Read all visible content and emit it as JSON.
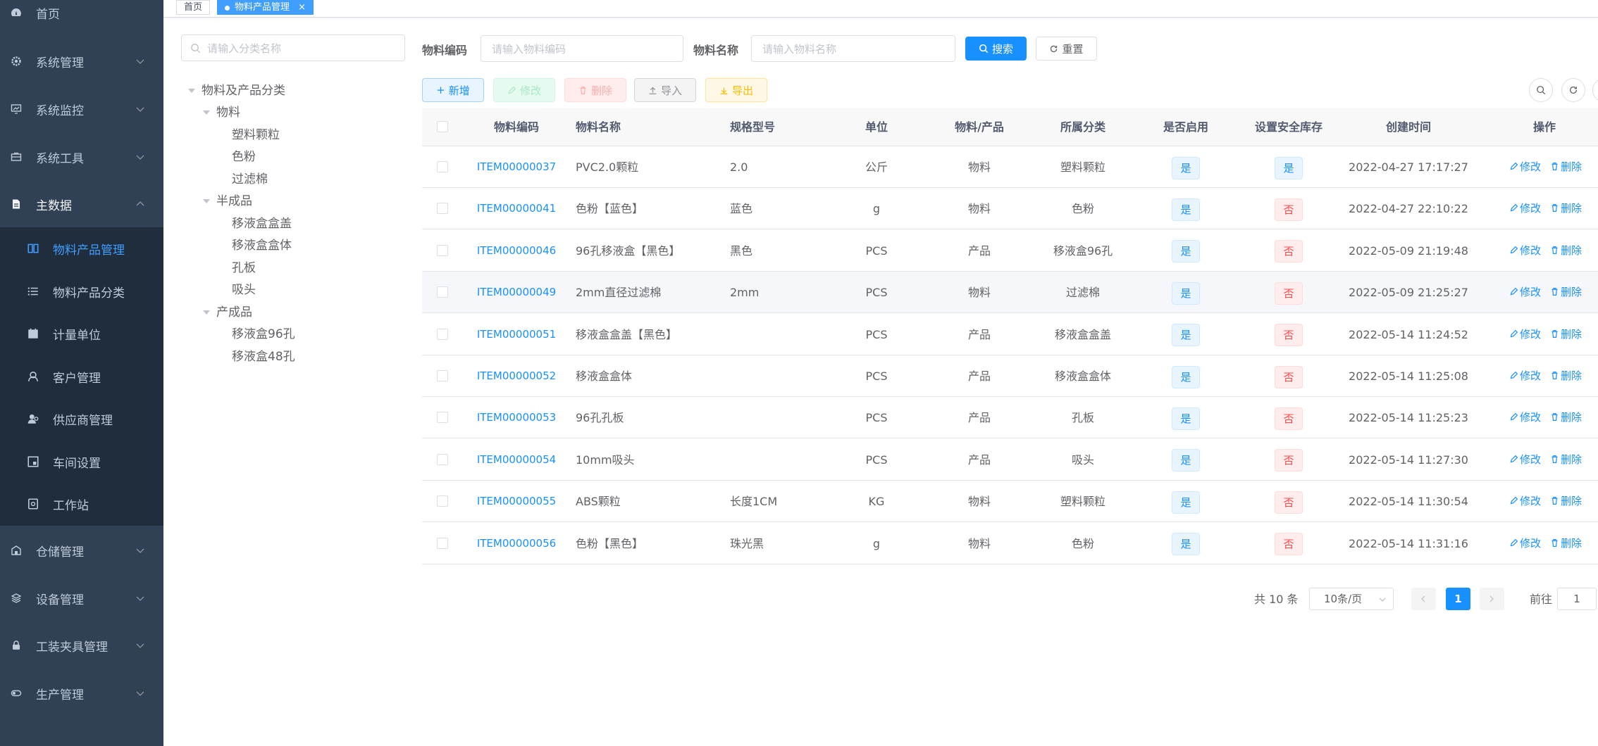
{
  "sidebar": {
    "home": "首页",
    "groups": [
      {
        "label": "系统管理",
        "icon": "gear-icon"
      },
      {
        "label": "系统监控",
        "icon": "monitor-icon"
      },
      {
        "label": "系统工具",
        "icon": "toolbox-icon"
      },
      {
        "label": "主数据",
        "icon": "document-icon"
      },
      {
        "label": "仓储管理",
        "icon": "warehouse-icon"
      },
      {
        "label": "设备管理",
        "icon": "layers-icon"
      },
      {
        "label": "工装夹具管理",
        "icon": "lock-icon"
      },
      {
        "label": "生产管理",
        "icon": "toggle-icon"
      }
    ],
    "sub_items": [
      {
        "label": "物料产品管理",
        "icon": "book-icon"
      },
      {
        "label": "物料产品分类",
        "icon": "list-icon"
      },
      {
        "label": "计量单位",
        "icon": "calendar-icon"
      },
      {
        "label": "客户管理",
        "icon": "customer-icon"
      },
      {
        "label": "供应商管理",
        "icon": "supplier-icon"
      },
      {
        "label": "车间设置",
        "icon": "workshop-icon"
      },
      {
        "label": "工作站",
        "icon": "workstation-icon"
      }
    ]
  },
  "tags": {
    "home": "首页",
    "current": "物料产品管理",
    "close": "×"
  },
  "tree": {
    "search_placeholder": "请输入分类名称",
    "root": "物料及产品分类",
    "groups": [
      {
        "label": "物料",
        "children": [
          "塑料颗粒",
          "色粉",
          "过滤棉"
        ]
      },
      {
        "label": "半成品",
        "children": [
          "移液盒盒盖",
          "移液盒盒体",
          "孔板",
          "吸头"
        ]
      },
      {
        "label": "产成品",
        "children": [
          "移液盒96孔",
          "移液盒48孔"
        ]
      }
    ]
  },
  "search": {
    "code_label": "物料编码",
    "code_placeholder": "请输入物料编码",
    "name_label": "物料名称",
    "name_placeholder": "请输入物料名称",
    "search_btn": "搜索",
    "reset_btn": "重置"
  },
  "toolbar": {
    "add": "新增",
    "edit": "修改",
    "delete": "删除",
    "import": "导入",
    "export": "导出"
  },
  "table": {
    "headers": [
      "物料编码",
      "物料名称",
      "规格型号",
      "单位",
      "物料/产品",
      "所属分类",
      "是否启用",
      "设置安全库存",
      "创建时间",
      "操作"
    ],
    "edit_label": "修改",
    "delete_label": "删除",
    "rows": [
      {
        "code": "ITEM00000037",
        "name": "PVC2.0颗粒",
        "spec": "2.0",
        "unit": "公斤",
        "type": "物料",
        "category": "塑料颗粒",
        "enabled": "是",
        "safe_stock": "是",
        "created": "2022-04-27 17:17:27"
      },
      {
        "code": "ITEM00000041",
        "name": "色粉【蓝色】",
        "spec": "蓝色",
        "unit": "g",
        "type": "物料",
        "category": "色粉",
        "enabled": "是",
        "safe_stock": "否",
        "created": "2022-04-27 22:10:22"
      },
      {
        "code": "ITEM00000046",
        "name": "96孔移液盒【黑色】",
        "spec": "黑色",
        "unit": "PCS",
        "type": "产品",
        "category": "移液盒96孔",
        "enabled": "是",
        "safe_stock": "否",
        "created": "2022-05-09 21:19:48"
      },
      {
        "code": "ITEM00000049",
        "name": "2mm直径过滤棉",
        "spec": "2mm",
        "unit": "PCS",
        "type": "物料",
        "category": "过滤棉",
        "enabled": "是",
        "safe_stock": "否",
        "created": "2022-05-09 21:25:27"
      },
      {
        "code": "ITEM00000051",
        "name": "移液盒盒盖【黑色】",
        "spec": "",
        "unit": "PCS",
        "type": "产品",
        "category": "移液盒盒盖",
        "enabled": "是",
        "safe_stock": "否",
        "created": "2022-05-14 11:24:52"
      },
      {
        "code": "ITEM00000052",
        "name": "移液盒盒体",
        "spec": "",
        "unit": "PCS",
        "type": "产品",
        "category": "移液盒盒体",
        "enabled": "是",
        "safe_stock": "否",
        "created": "2022-05-14 11:25:08"
      },
      {
        "code": "ITEM00000053",
        "name": "96孔孔板",
        "spec": "",
        "unit": "PCS",
        "type": "产品",
        "category": "孔板",
        "enabled": "是",
        "safe_stock": "否",
        "created": "2022-05-14 11:25:23"
      },
      {
        "code": "ITEM00000054",
        "name": "10mm吸头",
        "spec": "",
        "unit": "PCS",
        "type": "产品",
        "category": "吸头",
        "enabled": "是",
        "safe_stock": "否",
        "created": "2022-05-14 11:27:30"
      },
      {
        "code": "ITEM00000055",
        "name": "ABS颗粒",
        "spec": "长度1CM",
        "unit": "KG",
        "type": "物料",
        "category": "塑料颗粒",
        "enabled": "是",
        "safe_stock": "否",
        "created": "2022-05-14 11:30:54"
      },
      {
        "code": "ITEM00000056",
        "name": "色粉【黑色】",
        "spec": "珠光黑",
        "unit": "g",
        "type": "物料",
        "category": "色粉",
        "enabled": "是",
        "safe_stock": "否",
        "created": "2022-05-14 11:31:16"
      }
    ]
  },
  "pagination": {
    "total": "共 10 条",
    "page_size": "10条/页",
    "current": "1",
    "goto_label": "前往",
    "goto_value": "1"
  },
  "colors": {
    "sidebar_bg": "#304156",
    "submenu_bg": "#1f2d3d",
    "primary": "#1890ff"
  }
}
